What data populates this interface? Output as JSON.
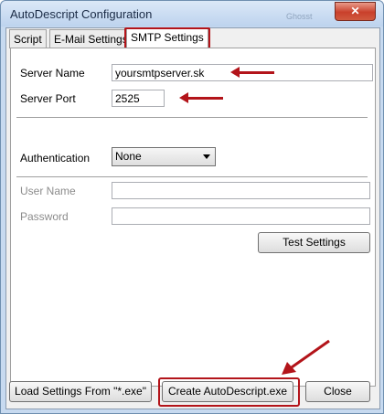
{
  "window": {
    "title": "AutoDescript Configuration",
    "title_ghost": "Ghosst",
    "close_glyph": "✕"
  },
  "tabs": [
    {
      "label": "Script"
    },
    {
      "label": "E-Mail Settings"
    },
    {
      "label": "SMTP Settings",
      "active": true
    }
  ],
  "smtp": {
    "server_name_label": "Server Name",
    "server_name_value": "yoursmtpserver.sk",
    "server_port_label": "Server Port",
    "server_port_value": "2525",
    "authentication_label": "Authentication",
    "authentication_value": "None",
    "user_name_label": "User Name",
    "user_name_value": "",
    "password_label": "Password",
    "password_value": "",
    "test_button": "Test Settings"
  },
  "footer": {
    "load_button": "Load Settings From \"*.exe\"",
    "create_button": "Create AutoDescript.exe",
    "close_button": "Close"
  },
  "colors": {
    "highlight": "#b3141a",
    "frame": "#c7daf0"
  }
}
